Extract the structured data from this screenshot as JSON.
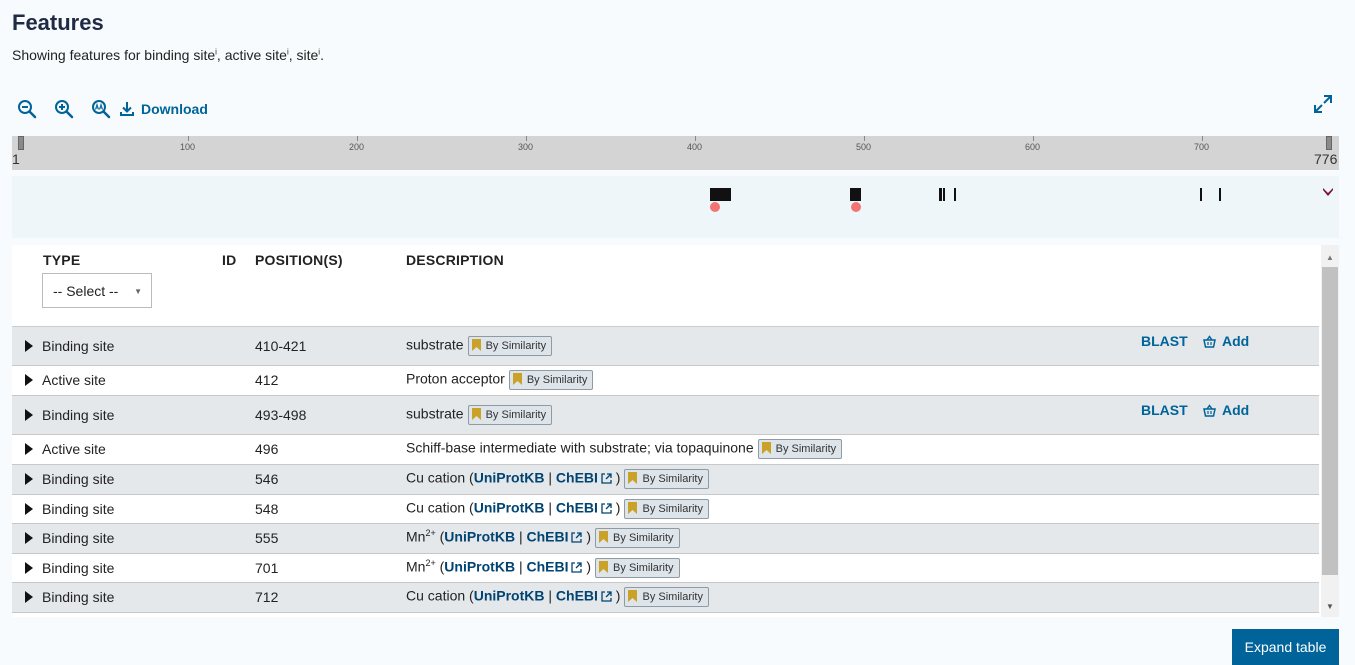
{
  "header": {
    "title": "Features",
    "subtitle_prefix": "Showing features for ",
    "subtitle_parts": [
      "binding site",
      "active site",
      "site"
    ],
    "info_marker": "i"
  },
  "toolbar": {
    "download_label": "Download"
  },
  "ruler": {
    "start": "1",
    "end": "776",
    "ticks": [
      "100",
      "200",
      "300",
      "400",
      "500",
      "600",
      "700"
    ]
  },
  "table": {
    "columns": {
      "type": "TYPE",
      "id": "ID",
      "positions": "POSITION(S)",
      "description": "DESCRIPTION"
    },
    "type_filter": {
      "selected": "-- Select --"
    },
    "evidence_label": "By Similarity",
    "blast_label": "BLAST",
    "add_label": "Add",
    "rows": [
      {
        "type": "Binding site",
        "position": "410-421",
        "desc": "substrate"
      },
      {
        "type": "Active site",
        "position": "412",
        "desc": "Proton acceptor"
      },
      {
        "type": "Binding site",
        "position": "493-498",
        "desc": "substrate"
      },
      {
        "type": "Active site",
        "position": "496",
        "desc": "Schiff-base intermediate with substrate; via topaquinone"
      },
      {
        "type": "Binding site",
        "position": "546",
        "desc_main": "Cu cation",
        "link1": "UniProtKB",
        "link2": "ChEBI"
      },
      {
        "type": "Binding site",
        "position": "548",
        "desc_main": "Cu cation",
        "link1": "UniProtKB",
        "link2": "ChEBI"
      },
      {
        "type": "Binding site",
        "position": "555",
        "desc_main": "Mn",
        "desc_sup": "2+",
        "link1": "UniProtKB",
        "link2": "ChEBI"
      },
      {
        "type": "Binding site",
        "position": "701",
        "desc_main": "Mn",
        "desc_sup": "2+",
        "link1": "UniProtKB",
        "link2": "ChEBI"
      },
      {
        "type": "Binding site",
        "position": "712",
        "desc_main": "Cu cation",
        "link1": "UniProtKB",
        "link2": "ChEBI"
      }
    ]
  },
  "expand_button": {
    "label": "Expand table"
  },
  "colors": {
    "accent": "#00639a",
    "link": "#014371",
    "evidence_flag": "#c9a227",
    "active_site_dot": "#f27474"
  }
}
